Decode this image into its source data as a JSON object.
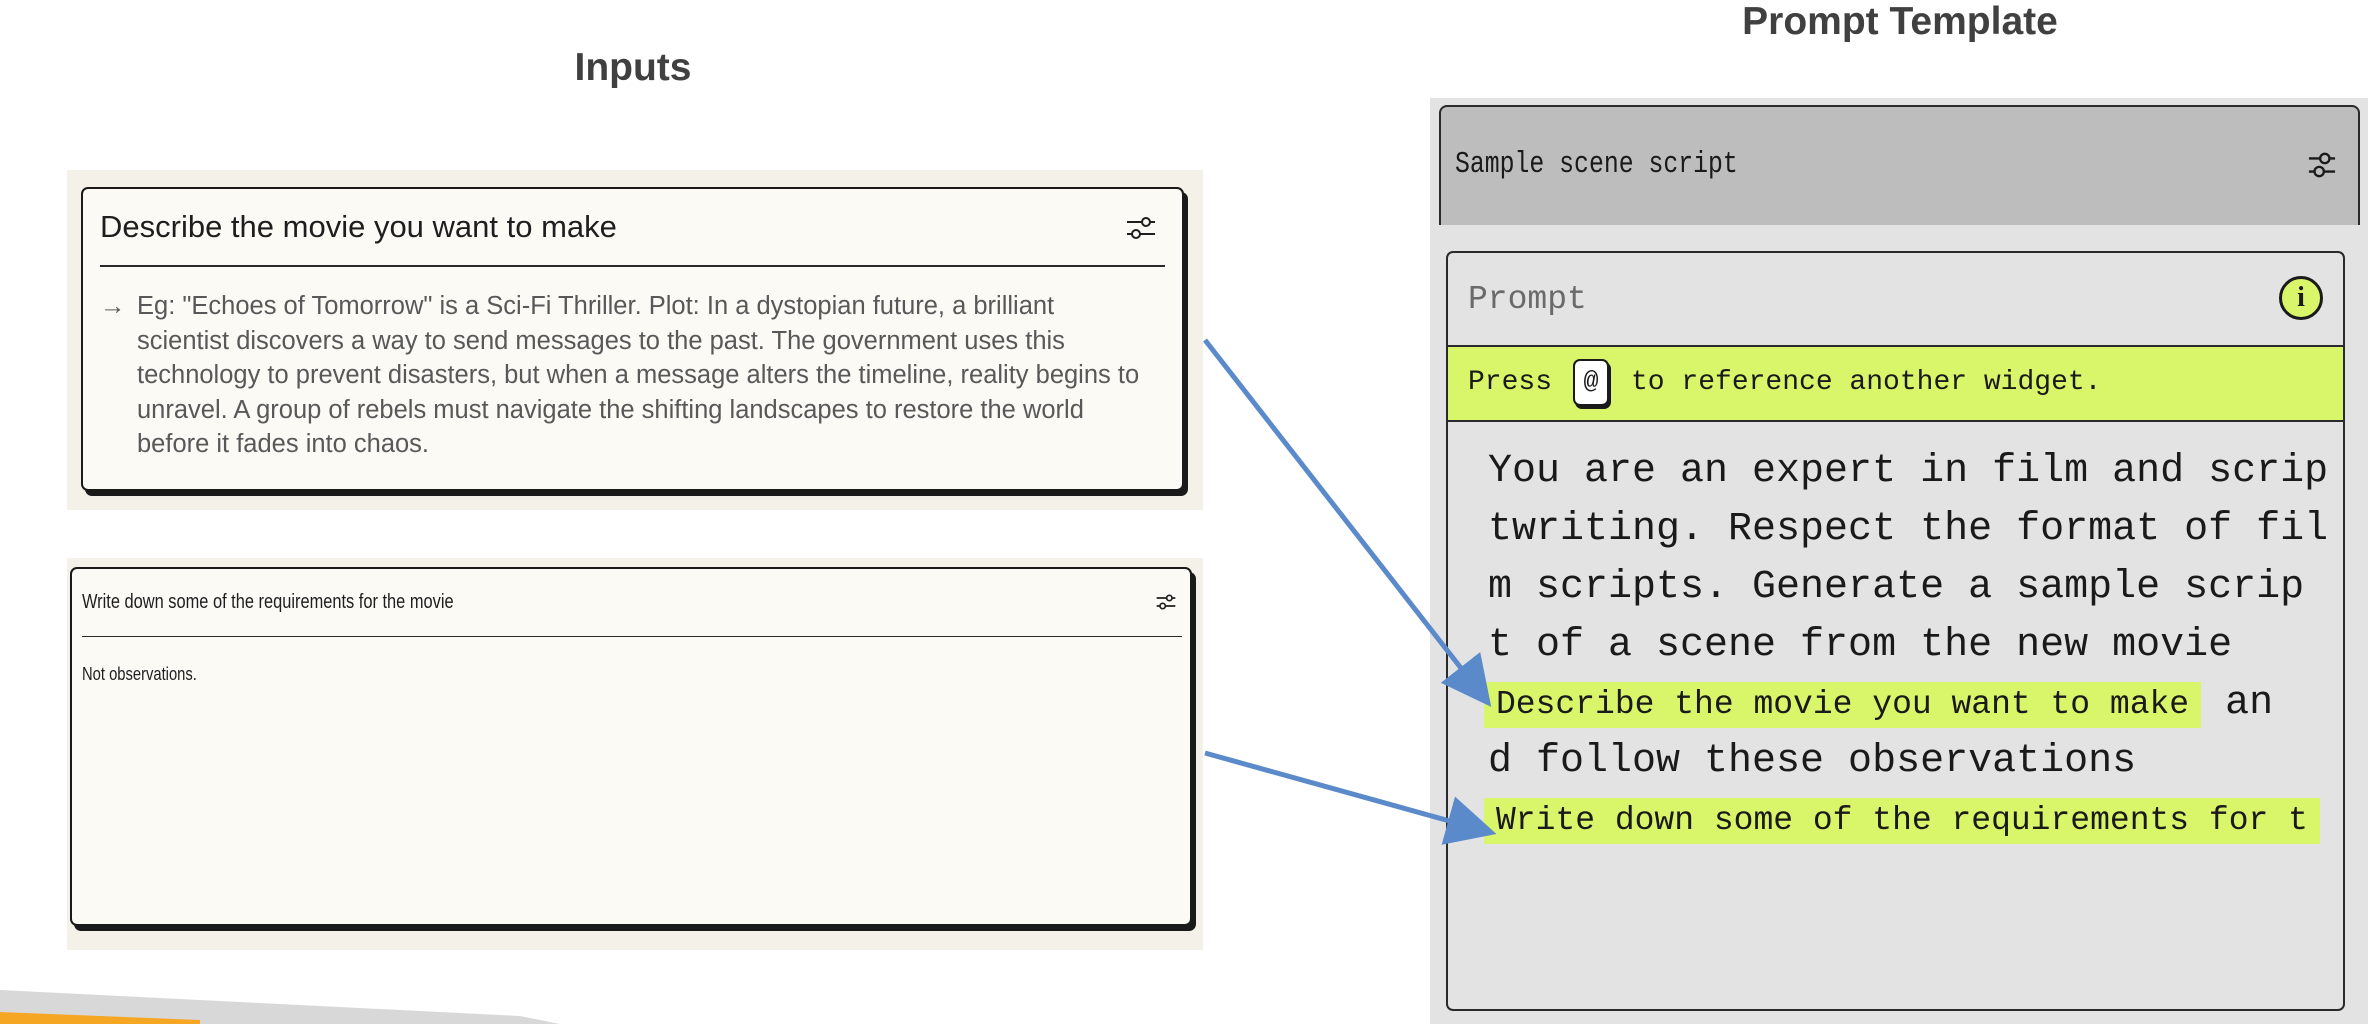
{
  "headings": {
    "inputs": "Inputs",
    "prompt_template": "Prompt Template"
  },
  "input_movie": {
    "title": "Describe the movie you want to make",
    "icon": "settings-sliders-icon",
    "arrow": "→",
    "placeholder": "Eg: \"Echoes of Tomorrow\" is a Sci-Fi Thriller. Plot: In a dystopian future, a brilliant scientist discovers a way to send messages to the past. The government uses this technology to prevent disasters, but when a message alters the timeline, reality begins to unravel. A group of rebels must navigate the shifting landscapes to restore the world before it fades into chaos."
  },
  "input_requirements": {
    "title": "Write down some of the requirements for the movie",
    "icon": "settings-sliders-icon",
    "value": "Not observations."
  },
  "template": {
    "header_title": "Sample scene script",
    "header_icon": "settings-sliders-icon",
    "prompt_label": "Prompt",
    "info_glyph": "i",
    "hint_prefix": "Press",
    "hint_key": "@",
    "hint_suffix": "to reference another widget.",
    "text_lines": [
      "You are an expert in film and scrip",
      "twriting. Respect the format of fil",
      "m scripts. Generate a sample scrip",
      "t of a scene from the new movie"
    ],
    "chip_movie": "Describe the movie you want to make",
    "after_chip_1": "an",
    "line_6": "d follow these observations",
    "chip_requirements": "Write down some of the requirements for t"
  },
  "colors": {
    "accent_lime": "#d9f56a",
    "arrow_blue": "#5b8acb",
    "panel_beige": "#f3f1e8",
    "template_gray": "#e3e3e3",
    "deco_orange": "#f5a623"
  }
}
